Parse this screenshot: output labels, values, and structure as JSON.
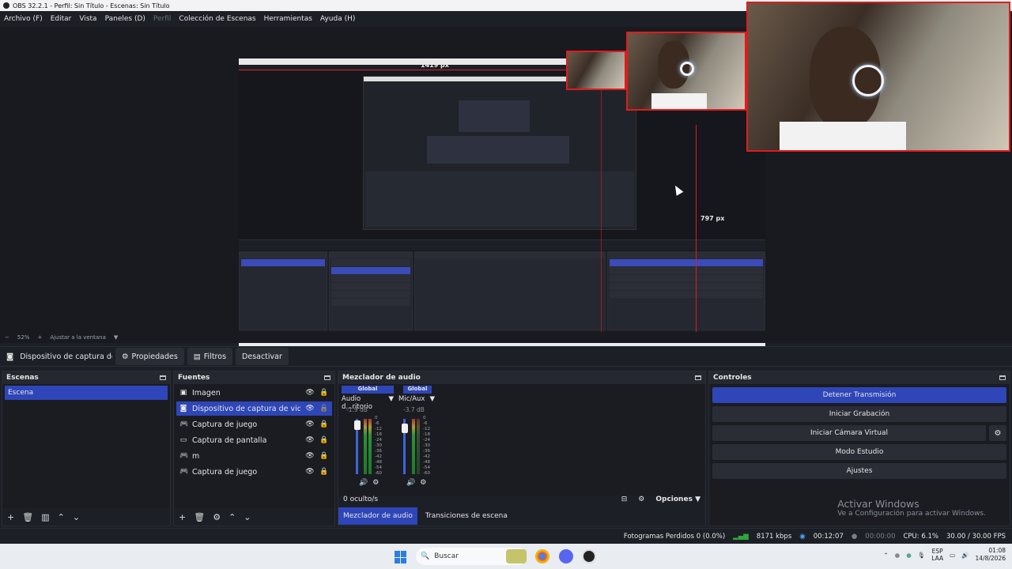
{
  "window": {
    "title": "OBS 32.2.1 - Perfil: Sin Título - Escenas: Sin Título"
  },
  "menu": [
    "Archivo (F)",
    "Editar",
    "Vista",
    "Paneles (D)",
    "Perfil",
    "Colección de Escenas",
    "Herramientas",
    "Ayuda (H)"
  ],
  "preview": {
    "measure_h": "1419 px",
    "measure_v": "797 px",
    "zoom": "52%",
    "fit": "Ajustar a la ventana"
  },
  "source_toolbar": {
    "current": "Dispositivo de captura de v",
    "properties": "Propiedades",
    "filters": "Filtros",
    "deactivate": "Desactivar"
  },
  "scenes": {
    "title": "Escenas",
    "items": [
      "Escena"
    ]
  },
  "sources": {
    "title": "Fuentes",
    "items": [
      {
        "name": "Imagen",
        "icon": "image-icon"
      },
      {
        "name": "Dispositivo de captura de video",
        "icon": "camera-icon"
      },
      {
        "name": "Captura de juego",
        "icon": "gamepad-icon"
      },
      {
        "name": "Captura de pantalla",
        "icon": "monitor-icon"
      },
      {
        "name": "m",
        "icon": "gamepad-icon"
      },
      {
        "name": "Captura de juego",
        "icon": "gamepad-icon"
      }
    ]
  },
  "mixer": {
    "title": "Mezclador de audio",
    "channels": [
      {
        "global": "Global",
        "name": "Audio d...ritorio",
        "db": "-1.9 dB"
      },
      {
        "global": "Global",
        "name": "Mic/Aux",
        "db": "-3.7 dB"
      }
    ],
    "scale": [
      "0",
      "-6",
      "-12",
      "-18",
      "-24",
      "-30",
      "-36",
      "-42",
      "-48",
      "-54",
      "-60"
    ],
    "scale2": [
      "0",
      "-6",
      "-12",
      "-18",
      "-24",
      "-30",
      "-36",
      "-42",
      "-48",
      "-54",
      "-60"
    ],
    "hidden": "0 oculto/s",
    "options": "Opciones",
    "tabs": [
      "Mezclador de audio",
      "Transiciones de escena"
    ]
  },
  "controls": {
    "title": "Controles",
    "buttons": [
      "Detener Transmisión",
      "Iniciar Grabación",
      "Iniciar Cámara Virtual",
      "Modo Estudio",
      "Ajustes"
    ],
    "activate_title": "Activar Windows",
    "activate_sub": "Ve a Configuración para activar Windows."
  },
  "status": {
    "dropped": "Fotogramas Perdidos 0 (0.0%)",
    "kbps": "8171 kbps",
    "stream_time": "00:12:07",
    "rec_time": "00:00:00",
    "cpu": "CPU: 6.1%",
    "fps": "30.00 / 30.00 FPS"
  },
  "taskbar": {
    "search": "Buscar",
    "lang1": "ESP",
    "lang2": "LAA",
    "time": "01:08",
    "date": "14/8/2026"
  },
  "colors": {
    "accent": "#2e46b8",
    "red": "#e11b1b",
    "bg": "#1d1f26"
  }
}
